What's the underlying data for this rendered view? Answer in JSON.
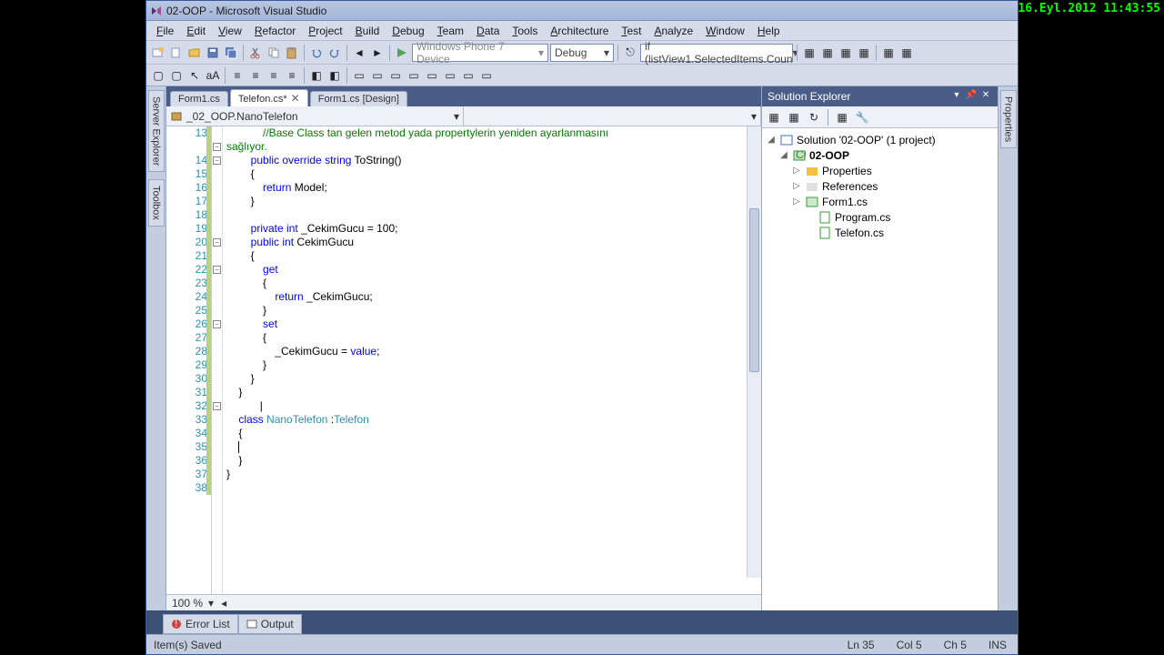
{
  "clock": "16.Eyl.2012 11:43:55",
  "window": {
    "title": "02-OOP - Microsoft Visual Studio"
  },
  "menu": [
    "File",
    "Edit",
    "View",
    "Refactor",
    "Project",
    "Build",
    "Debug",
    "Team",
    "Data",
    "Tools",
    "Architecture",
    "Test",
    "Analyze",
    "Window",
    "Help"
  ],
  "toolbar": {
    "platform": "Windows Phone 7 Device",
    "config": "Debug",
    "find": "if (listView1.SelectedItems.Coun"
  },
  "tabs": [
    {
      "label": "Form1.cs",
      "active": false
    },
    {
      "label": "Telefon.cs*",
      "active": true
    },
    {
      "label": "Form1.cs [Design]",
      "active": false
    }
  ],
  "nav": {
    "left": "_02_OOP.NanoTelefon",
    "right": ""
  },
  "code": {
    "first_line": 13,
    "lines": [
      {
        "n": 13,
        "html": "            <span class='cm'>//Base Class tan gelen metod yada propertylerin yeniden ayarlanmasını</span>"
      },
      {
        "n": 0,
        "html": "<span class='cm'>sağlıyor.</span>"
      },
      {
        "n": 14,
        "html": "        <span class='kw'>public</span> <span class='kw'>override</span> <span class='kw'>string</span> ToString()"
      },
      {
        "n": 15,
        "html": "        {"
      },
      {
        "n": 16,
        "html": "            <span class='kw'>return</span> Model;"
      },
      {
        "n": 17,
        "html": "        }"
      },
      {
        "n": 18,
        "html": ""
      },
      {
        "n": 19,
        "html": "        <span class='kw'>private</span> <span class='kw'>int</span> _CekimGucu = 100;"
      },
      {
        "n": 20,
        "html": "        <span class='kw'>public</span> <span class='kw'>int</span> CekimGucu"
      },
      {
        "n": 21,
        "html": "        {"
      },
      {
        "n": 22,
        "html": "            <span class='kw'>get</span>"
      },
      {
        "n": 23,
        "html": "            {"
      },
      {
        "n": 24,
        "html": "                <span class='kw'>return</span> _CekimGucu;"
      },
      {
        "n": 25,
        "html": "            }"
      },
      {
        "n": 26,
        "html": "            <span class='kw'>set</span>"
      },
      {
        "n": 27,
        "html": "            {"
      },
      {
        "n": 28,
        "html": "                _CekimGucu = <span class='kw'>value</span>;"
      },
      {
        "n": 29,
        "html": "            }"
      },
      {
        "n": 30,
        "html": "        }"
      },
      {
        "n": 31,
        "html": "    }"
      },
      {
        "n": 32,
        "html": "           |"
      },
      {
        "n": 33,
        "html": "    <span class='kw'>class</span> <span class='tp'>NanoTelefon</span> :<span class='tp'>Telefon</span>"
      },
      {
        "n": 34,
        "html": "    {"
      },
      {
        "n": 35,
        "html": "    <span class='cursor'></span>"
      },
      {
        "n": 36,
        "html": "    }"
      },
      {
        "n": 37,
        "html": "}"
      },
      {
        "n": 38,
        "html": ""
      }
    ]
  },
  "zoom": "100 %",
  "solution": {
    "title": "Solution Explorer",
    "root": "Solution '02-OOP' (1 project)",
    "project": "02-OOP",
    "items": [
      "Properties",
      "References",
      "Form1.cs",
      "Program.cs",
      "Telefon.cs"
    ]
  },
  "side_left": [
    "Server Explorer",
    "Toolbox"
  ],
  "side_right": [
    "Properties"
  ],
  "bottom": [
    "Error List",
    "Output"
  ],
  "status": {
    "msg": "Item(s) Saved",
    "ln": "Ln 35",
    "col": "Col 5",
    "ch": "Ch 5",
    "ins": "INS"
  }
}
